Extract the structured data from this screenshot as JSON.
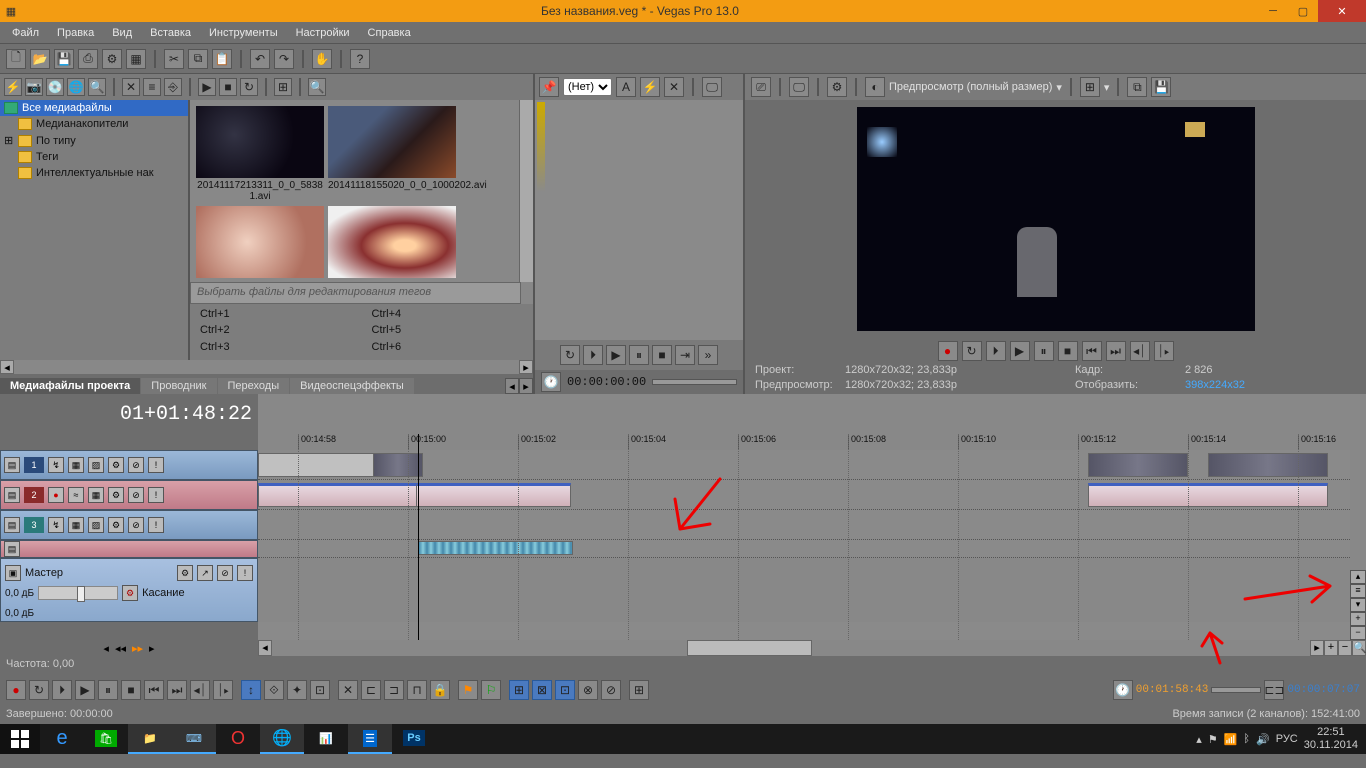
{
  "window": {
    "title": "Без названия.veg * - Vegas Pro 13.0"
  },
  "menu": {
    "file": "Файл",
    "edit": "Правка",
    "view": "Вид",
    "insert": "Вставка",
    "tools": "Инструменты",
    "options": "Настройки",
    "help": "Справка"
  },
  "media": {
    "tree": {
      "all": "Все медиафайлы",
      "drives": "Медианакопители",
      "bytype": "По типу",
      "tags": "Теги",
      "smart": "Интеллектуальные нак"
    },
    "thumbs": [
      {
        "label": "20141117213311_0_0_5838 1.avi"
      },
      {
        "label": "20141118155020_0_0_1000202.avi"
      }
    ],
    "tag_placeholder": "Выбрать файлы для редактирования тегов",
    "shortcuts": {
      "c1": "Ctrl+1",
      "c2": "Ctrl+2",
      "c3": "Ctrl+3",
      "c4": "Ctrl+4",
      "c5": "Ctrl+5",
      "c6": "Ctrl+6"
    },
    "tabs": {
      "media": "Медиафайлы проекта",
      "explorer": "Проводник",
      "transitions": "Переходы",
      "videofx": "Видеоспецэффекты"
    }
  },
  "middle": {
    "preset_none": "(Нет)",
    "timecode": "00:00:00:00"
  },
  "preview": {
    "label": "Предпросмотр (полный размер)",
    "info": {
      "project_lbl": "Проект:",
      "project_val": "1280x720x32; 23,833p",
      "preview_lbl": "Предпросмотр:",
      "preview_val": "1280x720x32; 23,833p",
      "frame_lbl": "Кадр:",
      "frame_val": "2 826",
      "display_lbl": "Отобразить:",
      "display_val": "398x224x32"
    }
  },
  "timecode": "01+01:48:22",
  "ruler_ticks": [
    "00:14:58",
    "00:15:00",
    "00:15:02",
    "00:15:04",
    "00:15:06",
    "00:15:08",
    "00:15:10",
    "00:15:12",
    "00:15:14",
    "00:15:16"
  ],
  "track_master": {
    "label": "Мастер",
    "db": "0,0 дБ",
    "touch": "Касание"
  },
  "bottom_status": {
    "freq": "Частота: 0,00",
    "done": "Завершено: 00:00:00",
    "rec_time": "Время записи (2 каналов): 152:41:00"
  },
  "transport_tc": {
    "pos": "00:01:58:43",
    "len": "00:00:07:07"
  },
  "taskbar": {
    "lang": "РУС",
    "time": "22:51",
    "date": "30.11.2014"
  },
  "track_nums": [
    "1",
    "2",
    "3"
  ]
}
